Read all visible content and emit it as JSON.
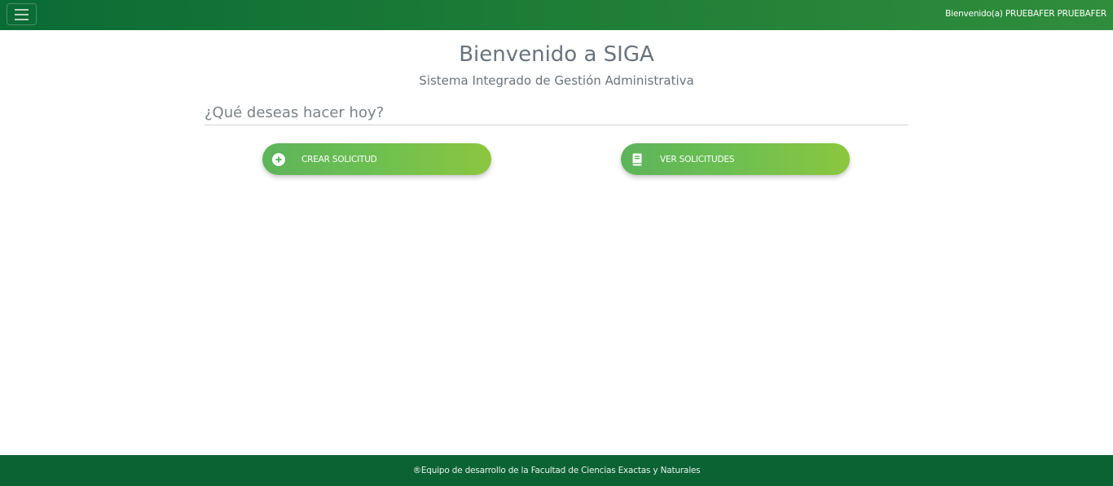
{
  "header": {
    "welcome_text": "Bienvenido(a) PRUEBAFER PRUEBAFER",
    "menu_icon": "hamburger-menu-icon"
  },
  "main": {
    "title": "Bienvenido a SIGA",
    "subtitle": "Sistema Integrado de Gestión Administrativa",
    "question": "¿Qué deseas hacer hoy?",
    "actions": [
      {
        "label": "CREAR SOLICITUD",
        "icon": "plus-circle-icon"
      },
      {
        "label": "VER SOLICITUDES",
        "icon": "book-icon"
      }
    ]
  },
  "footer": {
    "text": "®Equipo de desarrollo de la Facultad de Ciencias Exactas y Naturales"
  },
  "colors": {
    "header_green": "#1e7d36",
    "footer_green": "#0b6334",
    "button_gradient_start": "#5db45a",
    "button_gradient_end": "#8cc63f"
  }
}
